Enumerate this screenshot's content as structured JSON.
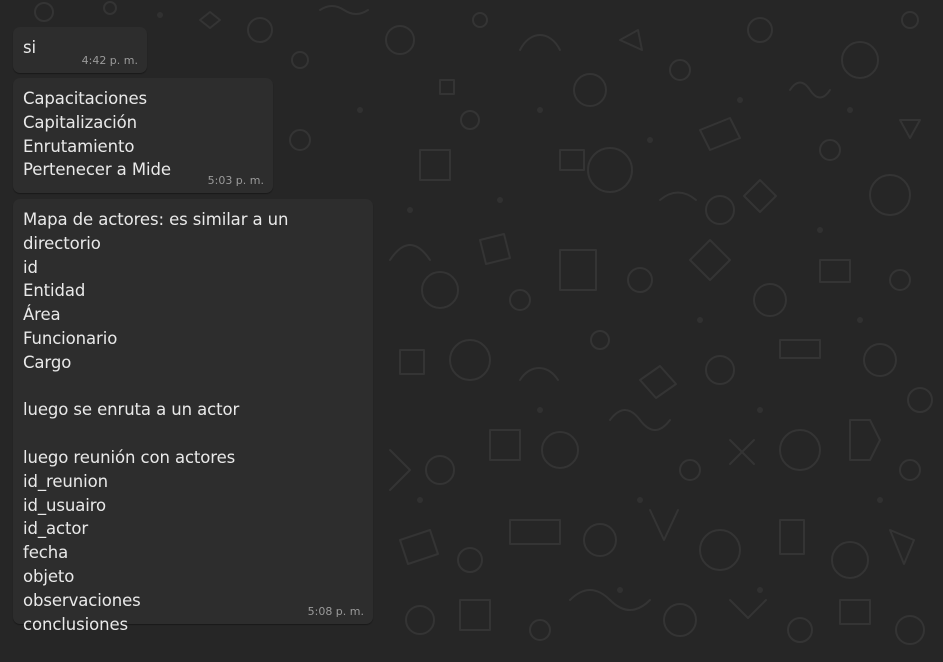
{
  "chat": {
    "messages": [
      {
        "text": "si",
        "time": "4:42 p. m."
      },
      {
        "text": "Capacitaciones\nCapitalización\nEnrutamiento\nPertenecer a Mide",
        "time": "5:03 p. m."
      },
      {
        "text": "Mapa de actores: es similar a un directorio\nid\nEntidad\nÁrea\nFuncionario\nCargo\n\nluego se enruta a un actor\n\nluego reunión con actores\nid_reunion\nid_usuairo\nid_actor\nfecha\nobjeto\nobservaciones\nconclusiones",
        "time": "5:08 p. m."
      }
    ]
  },
  "colors": {
    "background": "#262626",
    "bubble": "#2d2d2d",
    "text": "#e9e9e9",
    "timestamp": "#9a9a9a",
    "doodle": "#3a3a3a"
  }
}
